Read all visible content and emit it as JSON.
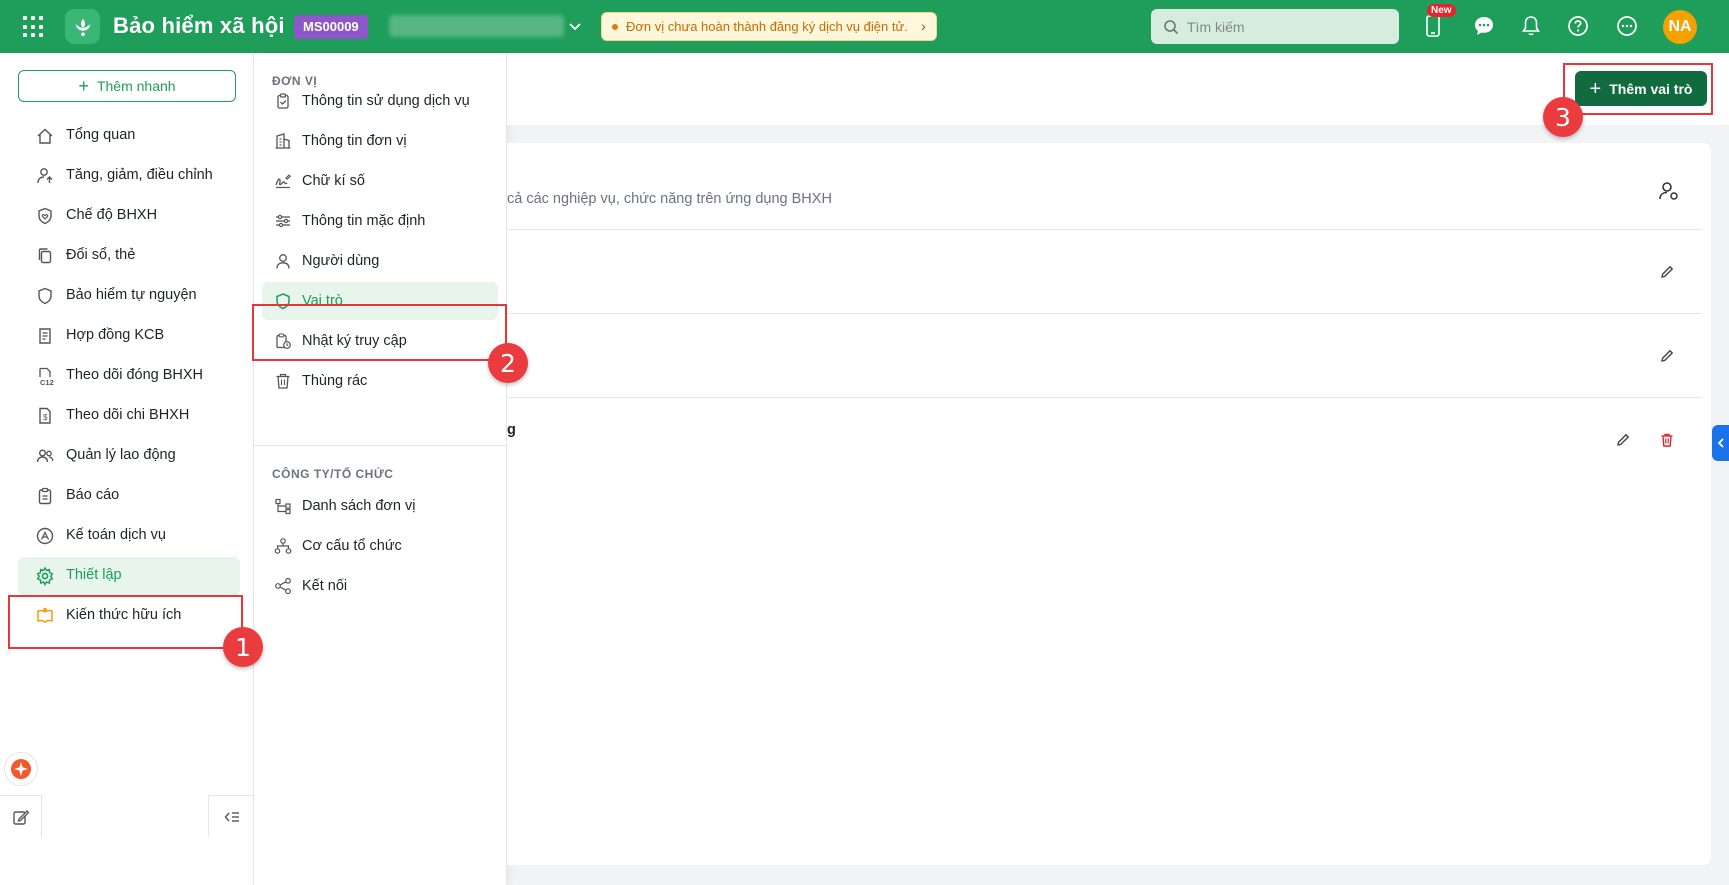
{
  "header": {
    "app_title": "Bảo hiểm xã hội",
    "org_code": "MS00009",
    "warning": "Đơn vị chưa hoàn thành đăng ký dịch vụ điện tử.",
    "search_placeholder": "Tìm kiếm",
    "new_badge": "New",
    "avatar_initials": "NA"
  },
  "sidebar": {
    "quick_add": "Thêm nhanh",
    "items": [
      {
        "label": "Tổng quan",
        "icon": "home-icon"
      },
      {
        "label": "Tăng, giảm, điều chỉnh",
        "icon": "user-arrow-icon"
      },
      {
        "label": "Chế độ BHXH",
        "icon": "shield-heart-icon"
      },
      {
        "label": "Đổi sổ, thẻ",
        "icon": "copy-icon"
      },
      {
        "label": "Bảo hiểm tự nguyện",
        "icon": "shield-icon"
      },
      {
        "label": "Hợp đồng KCB",
        "icon": "contract-icon"
      },
      {
        "label": "Theo dõi đóng BHXH",
        "icon": "c12-icon"
      },
      {
        "label": "Theo dõi chi BHXH",
        "icon": "file-money-icon"
      },
      {
        "label": "Quản lý lao động",
        "icon": "users-icon"
      },
      {
        "label": "Báo cáo",
        "icon": "clipboard-icon"
      },
      {
        "label": "Kế toán dịch vụ",
        "icon": "accounting-icon"
      },
      {
        "label": "Thiết lập",
        "icon": "gear-icon"
      },
      {
        "label": "Kiến thức hữu ích",
        "icon": "book-icon"
      }
    ]
  },
  "submenu": {
    "section1_title": "ĐƠN VỊ",
    "section1_items": [
      {
        "label": "Thông tin sử dụng dịch vụ",
        "icon": "clipboard-check-icon"
      },
      {
        "label": "Thông tin đơn vị",
        "icon": "building-icon"
      },
      {
        "label": "Chữ kí số",
        "icon": "signature-icon"
      },
      {
        "label": "Thông tin mặc định",
        "icon": "sliders-icon"
      },
      {
        "label": "Người dùng",
        "icon": "user-icon"
      },
      {
        "label": "Vai trò",
        "icon": "shield-icon"
      },
      {
        "label": "Nhật ký truy cập",
        "icon": "log-icon"
      },
      {
        "label": "Thùng rác",
        "icon": "trash-icon"
      }
    ],
    "section2_title": "CÔNG TY/TỔ CHỨC",
    "section2_items": [
      {
        "label": "Danh sách đơn vị",
        "icon": "hierarchy-icon"
      },
      {
        "label": "Cơ cấu tổ chức",
        "icon": "org-chart-icon"
      },
      {
        "label": "Kết nối",
        "icon": "share-icon"
      }
    ]
  },
  "main": {
    "add_role_button": "Thêm vai trò",
    "description_fragment": "cả các nghiệp vụ, chức năng trên ứng dụng BHXH",
    "row3_fragment": "g"
  },
  "annotations": {
    "marker1": "1",
    "marker2": "2",
    "marker3": "3"
  },
  "colors": {
    "brand_green": "#1e9e5a",
    "dark_green": "#106b3e",
    "annotation_red": "#e5373a",
    "org_badge": "#8e57c9",
    "avatar": "#f5a100"
  }
}
